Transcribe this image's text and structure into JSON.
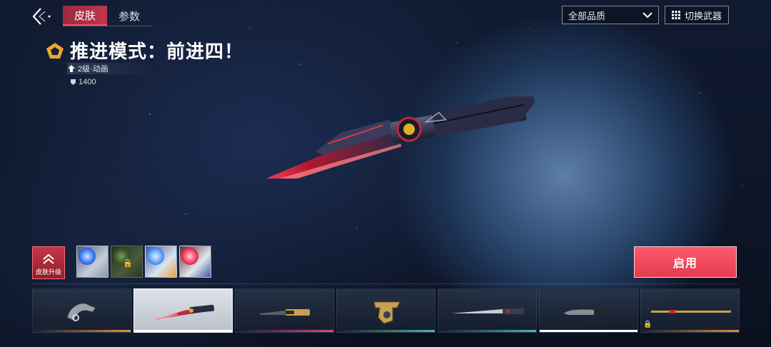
{
  "header": {
    "tabs": [
      {
        "label": "皮肤",
        "active": true
      },
      {
        "label": "参数",
        "active": false
      }
    ],
    "quality_filter": {
      "selected": "全部品质"
    },
    "switch_weapon_label": "切换武器"
  },
  "skin": {
    "name": "推进模式：前进四！",
    "level_text": "2级·动画",
    "price": "1400"
  },
  "upgrade": {
    "label": "皮肤升级"
  },
  "chromas": [
    {
      "color": "#4a8cff",
      "locked": false
    },
    {
      "color": "#3a5a2a",
      "locked": true
    },
    {
      "color": "#5aa0ff",
      "locked": false
    },
    {
      "color": "#ff3a5e",
      "locked": false
    }
  ],
  "enable_label": "启用",
  "weapon_skins": [
    {
      "name": "karambit",
      "accent": "#d9903a",
      "locked": false
    },
    {
      "name": "forward-knife",
      "accent": "#ffffff",
      "locked": false,
      "selected": true
    },
    {
      "name": "gold-dagger",
      "accent": "#d94a7a",
      "locked": false
    },
    {
      "name": "gold-trench-knife",
      "accent": "#4ab8a0",
      "locked": false
    },
    {
      "name": "long-blade",
      "accent": "#4ab8a0",
      "locked": false
    },
    {
      "name": "combat-knife",
      "accent": "#ffffff",
      "locked": false
    },
    {
      "name": "gold-staff",
      "accent": "#d9903a",
      "locked": true
    }
  ],
  "colors": {
    "accent_red": "#e33c50",
    "tab_active": "#c0364d"
  }
}
